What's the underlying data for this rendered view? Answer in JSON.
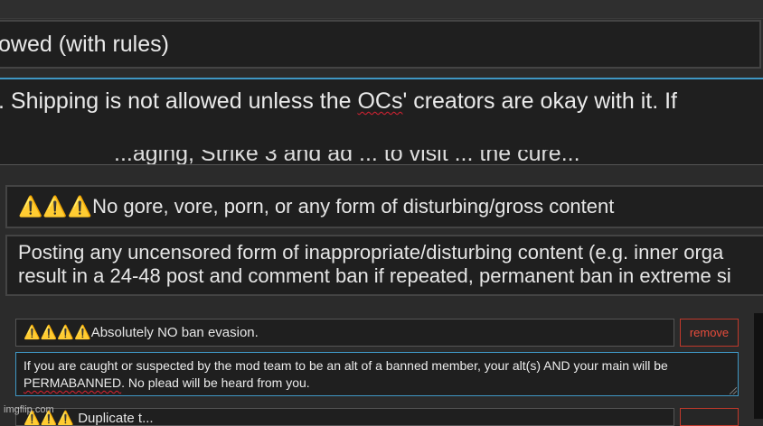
{
  "rule1": {
    "title_fragment": "owed (with rules)",
    "desc_before": ". Shipping is not allowed unless the ",
    "desc_misspelled": "OCs",
    "desc_after": "' creators are okay with it. If",
    "desc_cutoff_line": "...aging, Strike 3 and ad ... to visit ... the cure..."
  },
  "rule2": {
    "title": "⚠️⚠️⚠️No gore, vore, porn, or any form of disturbing/gross content",
    "desc_line1": "Posting any uncensored form of inappropriate/disturbing content (e.g. inner orga",
    "desc_line2": "result in a 24-48 post and comment ban if repeated, permanent ban in extreme si"
  },
  "rule3": {
    "title": "⚠️⚠️⚠️⚠️Absolutely NO ban evasion.",
    "remove_label": "remove",
    "desc_part1": "If you are caught or suspected by the mod team to be an alt of a banned member, your alt(s) AND your main will be ",
    "desc_misspelled": "PERMABANNED",
    "desc_part2": ". No plead will be heard from you."
  },
  "rule4": {
    "title_fragment": "⚠️⚠️⚠️ Duplicate t..."
  },
  "watermark": "imgflip.com",
  "colors": {
    "background": "#2b2b2b",
    "field_background": "#1f1f1f",
    "focus_border": "#3f97c4",
    "remove_red": "#e74c3c",
    "spellcheck_red": "#dd2233"
  }
}
